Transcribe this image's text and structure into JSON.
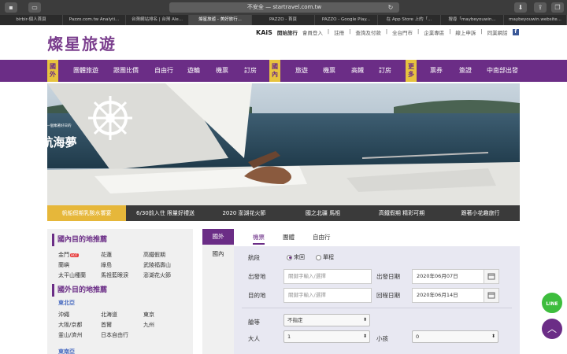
{
  "browser": {
    "url": "不安全 — startravel.com.tw",
    "tabs": [
      {
        "label": "birbir-個人首頁"
      },
      {
        "label": "Pazzo.com.tw Analyti..."
      },
      {
        "label": "台灣網站排名 | 台灣 Ale..."
      },
      {
        "label": "燦星旅遊 - 美好旅行..."
      },
      {
        "label": "PAZZO - 首頁"
      },
      {
        "label": "PAZZO - Google Play..."
      },
      {
        "label": "在 App Store 上的「..."
      },
      {
        "label": "搜尋「maybeyouwin..."
      },
      {
        "label": "maybeyouwin.website..."
      }
    ],
    "active_tab": 3
  },
  "header": {
    "logo": "燦星旅遊",
    "kais": "KAiS",
    "brand": "開始旅行",
    "links": [
      "會員登入",
      "註冊",
      "查詢及付款",
      "全台門市",
      "企業專區",
      "線上申訴",
      "同業網話"
    ],
    "separator": "|"
  },
  "nav": {
    "groups": [
      {
        "tag": "國外",
        "items": [
          "團體旅遊",
          "跟團比價",
          "自由行",
          "遊輪",
          "機票",
          "訂房"
        ]
      },
      {
        "tag": "國內",
        "items": [
          "旅遊",
          "機票",
          "高鐵",
          "訂房"
        ]
      },
      {
        "tag": "更多",
        "items": [
          "票券",
          "簽證",
          "中南部出發"
        ]
      }
    ]
  },
  "banner": {
    "slogan": "許一個乘著好日的",
    "title": "航海夢",
    "colors": {
      "sea": "#2c4a5e",
      "sky": "#9fb3c4",
      "deck": "#e8e8e6"
    }
  },
  "banner_tabs": [
    {
      "label": "帆船假期乳酸水饗宴",
      "active": true
    },
    {
      "label": "6/30前入住 限量好禮送",
      "active": false
    },
    {
      "label": "2020 澎湖花火節",
      "active": false
    },
    {
      "label": "國之北疆 馬祖",
      "active": false
    },
    {
      "label": "高鐵假期 精彩可期",
      "active": false
    },
    {
      "label": "跟著小花趣旅行",
      "active": false
    }
  ],
  "destinations": {
    "domestic_title": "國內目的地推薦",
    "domestic": [
      "金門",
      "花蓮",
      "高鐵假期",
      "蘭嶼",
      "綠島",
      "武陵福壽山",
      "太平山種蘭",
      "馬祖藍眼淚",
      "澎湖花火節"
    ],
    "hot_badge": "HOT",
    "foreign_title": "國外目的地推薦",
    "northeast_asia": "東北亞",
    "foreign": [
      "沖繩",
      "北海道",
      "東京",
      "大阪/京都",
      "首爾",
      "九州",
      "釜山/濟州",
      "日本自由行"
    ],
    "southeast_asia": "東南亞"
  },
  "search": {
    "side_tabs": [
      "國外",
      "國內"
    ],
    "top_tabs": [
      "機票",
      "團體",
      "自由行"
    ],
    "trip_label": "航段",
    "trip_options": [
      "來回",
      "單程"
    ],
    "depart_label": "出發地",
    "depart_placeholder": "關鍵字輸入/選擇",
    "dest_label": "目的地",
    "dest_placeholder": "關鍵字輸入/選擇",
    "depart_date_label": "出發日期",
    "depart_date": "2020年06月07日",
    "return_date_label": "回程日期",
    "return_date": "2020年06月14日",
    "class_label": "艙等",
    "class_value": "不指定",
    "adult_label": "大人",
    "adult_value": "1",
    "child_label": "小孩",
    "child_value": "0"
  },
  "floating": {
    "line": "LINE",
    "top": "︿"
  },
  "colors": {
    "brand": "#6b2d86",
    "accent": "#e6b73a"
  }
}
